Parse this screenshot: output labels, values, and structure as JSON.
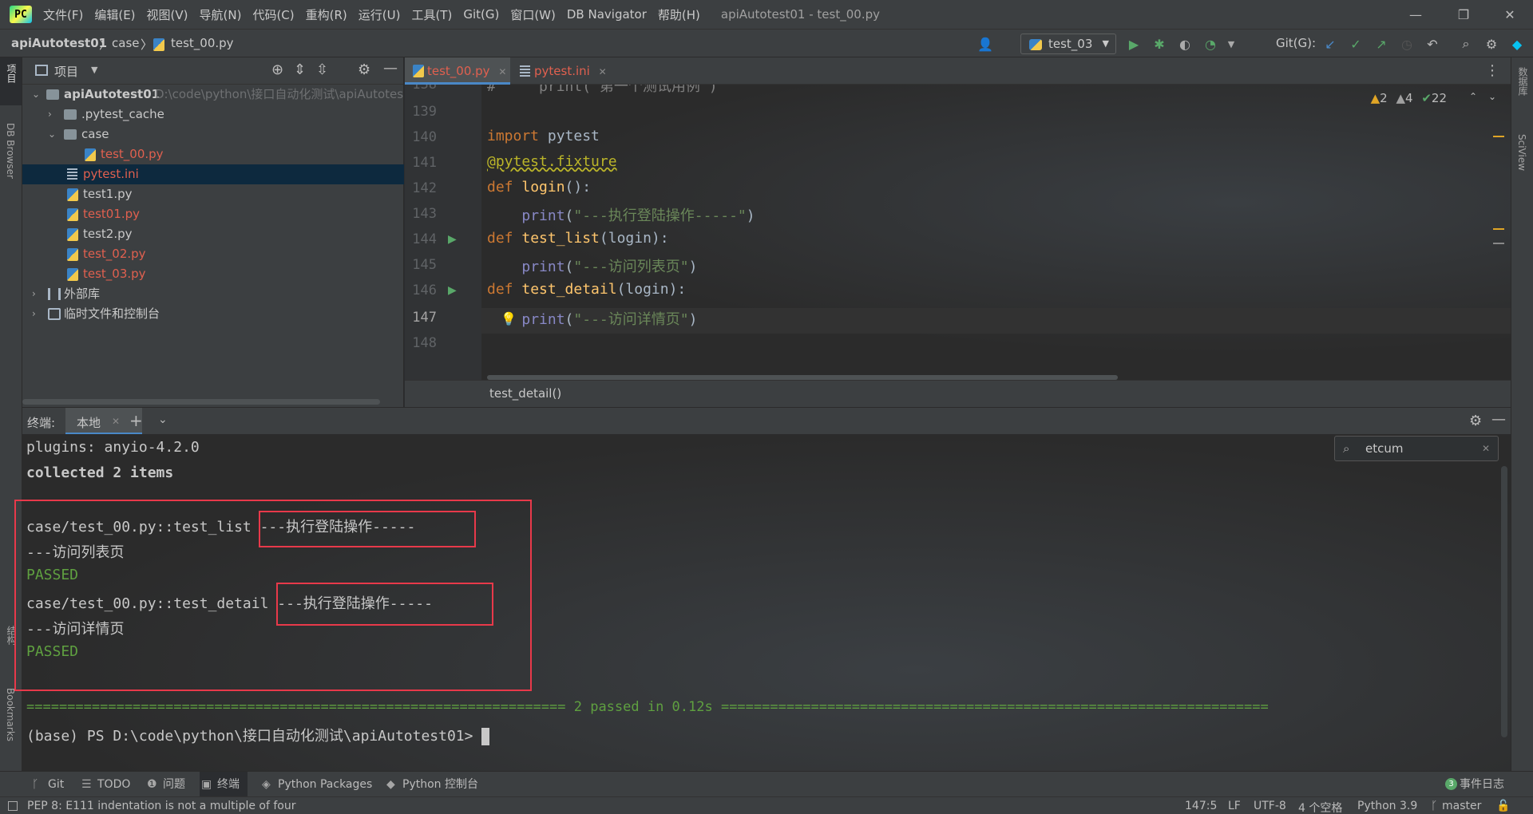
{
  "titlebar": {
    "menus": [
      "文件(F)",
      "编辑(E)",
      "视图(V)",
      "导航(N)",
      "代码(C)",
      "重构(R)",
      "运行(U)",
      "工具(T)",
      "Git(G)",
      "窗口(W)",
      "DB Navigator",
      "帮助(H)"
    ],
    "window_title": "apiAutotest01 - test_00.py"
  },
  "navbar": {
    "breadcrumb": [
      "apiAutotest01",
      "case",
      "test_00.py"
    ],
    "run_config": "test_03",
    "git_label": "Git(G):"
  },
  "left_strip": {
    "project_label": "项目",
    "db_browser_label": "DB Browser",
    "structure_label": "结构",
    "bookmarks_label": "Bookmarks"
  },
  "right_strip": {
    "database_label": "数据库",
    "sciview_label": "SciView"
  },
  "project_panel": {
    "title": "项目",
    "tree": [
      {
        "label": "apiAutotest01",
        "hint": "D:\\code\\python\\接口自动化测试\\apiAutotes",
        "kind": "folder",
        "depth": 0,
        "expanded": true
      },
      {
        "label": ".pytest_cache",
        "kind": "folder",
        "depth": 1,
        "expanded": false
      },
      {
        "label": "case",
        "kind": "folder",
        "depth": 1,
        "expanded": true
      },
      {
        "label": "test_00.py",
        "kind": "py",
        "depth": 2,
        "color": "red"
      },
      {
        "label": "pytest.ini",
        "kind": "ini",
        "depth": 1,
        "color": "red",
        "selected": true
      },
      {
        "label": "test1.py",
        "kind": "py",
        "depth": 1
      },
      {
        "label": "test01.py",
        "kind": "py",
        "depth": 1,
        "color": "red"
      },
      {
        "label": "test2.py",
        "kind": "py",
        "depth": 1
      },
      {
        "label": "test_02.py",
        "kind": "py",
        "depth": 1,
        "color": "red"
      },
      {
        "label": "test_03.py",
        "kind": "py",
        "depth": 1,
        "color": "red"
      },
      {
        "label": "外部库",
        "kind": "lib",
        "depth": 0,
        "expanded": false
      },
      {
        "label": "临时文件和控制台",
        "kind": "scratch",
        "depth": 0,
        "expanded": false
      }
    ]
  },
  "editor": {
    "tabs": [
      {
        "label": "test_00.py",
        "active": true
      },
      {
        "label": "pytest.ini",
        "active": false
      }
    ],
    "inspections": {
      "warnings": "2",
      "weak_warnings": "4",
      "ok": "22"
    },
    "lines": [
      {
        "num": "138",
        "text": "#     print(\"第一个测试用例\")"
      },
      {
        "num": "139",
        "text": ""
      },
      {
        "num": "140",
        "text": "import pytest"
      },
      {
        "num": "141",
        "text": "@pytest.fixture"
      },
      {
        "num": "142",
        "text": "def login():"
      },
      {
        "num": "143",
        "text": "    print(\"---执行登陆操作-----\")"
      },
      {
        "num": "144",
        "text": "def test_list(login):"
      },
      {
        "num": "145",
        "text": "    print(\"---访问列表页\")"
      },
      {
        "num": "146",
        "text": "def test_detail(login):"
      },
      {
        "num": "147",
        "text": "    print(\"---访问详情页\")"
      },
      {
        "num": "148",
        "text": ""
      }
    ],
    "breadcrumb_footer": "test_detail()"
  },
  "terminal": {
    "title": "终端:",
    "tab": "本地",
    "search_value": "etcum",
    "lines": [
      "plugins: anyio-4.2.0",
      "collected 2 items",
      "",
      "case/test_00.py::test_list ---执行登陆操作-----",
      "---访问列表页",
      "PASSED",
      "case/test_00.py::test_detail ---执行登陆操作-----",
      "---访问详情页",
      "PASSED"
    ],
    "summary_line": "================================================================== 2 passed in 0.12s ===================================================================",
    "prompt": "(base) PS D:\\code\\python\\接口自动化测试\\apiAutotest01>"
  },
  "tool_tabs": [
    {
      "label": "Git",
      "icon": "git-branch-icon"
    },
    {
      "label": "TODO",
      "icon": "list-icon"
    },
    {
      "label": "问题",
      "icon": "info-icon"
    },
    {
      "label": "终端",
      "icon": "terminal-icon",
      "active": true
    },
    {
      "label": "Python Packages",
      "icon": "layers-icon"
    },
    {
      "label": "Python 控制台",
      "icon": "python-icon"
    }
  ],
  "event_log": {
    "count": "3",
    "label": "事件日志"
  },
  "statusbar": {
    "message": "PEP 8: E111 indentation is not a multiple of four",
    "position": "147:5",
    "line_sep": "LF",
    "encoding": "UTF-8",
    "indent": "4 个空格",
    "interpreter": "Python 3.9",
    "branch": "master"
  },
  "colors": {
    "accent": "#4a88c7",
    "highlight_box": "#e8394a",
    "passed": "#5fa040",
    "modified_file": "#e0604f"
  }
}
